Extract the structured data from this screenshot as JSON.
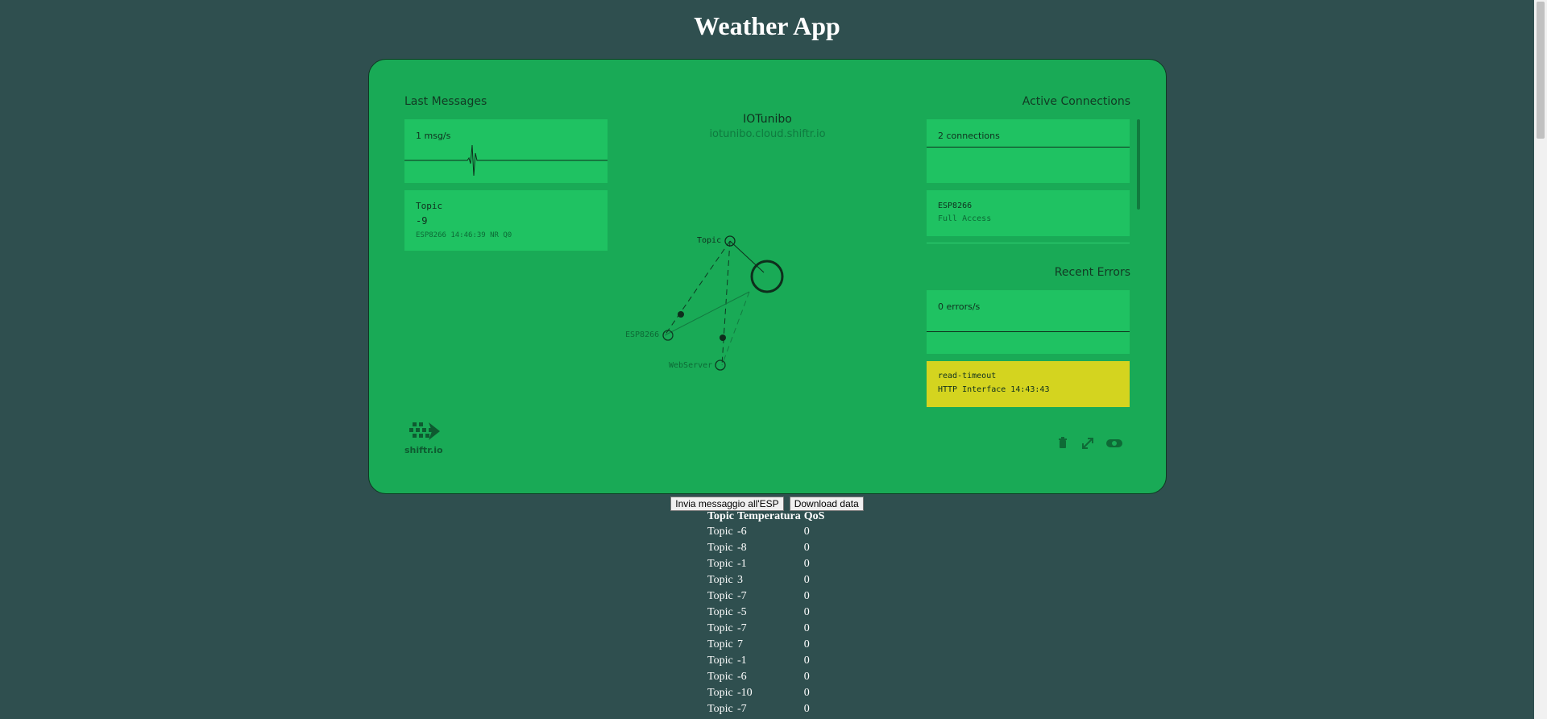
{
  "page": {
    "title": "Weather App"
  },
  "colors": {
    "background": "#2f4f4f",
    "panel": "#19aa56",
    "card": "#1fc262",
    "error_card": "#d4d41f"
  },
  "dashboard": {
    "last_messages": {
      "title": "Last Messages",
      "rate": "1 msg/s",
      "message": {
        "topic": "Topic",
        "value": "-9",
        "meta": "ESP8266 14:46:39 NR Q0"
      }
    },
    "broker": {
      "name": "IOTunibo",
      "host": "iotunibo.cloud.shiftr.io"
    },
    "graph": {
      "nodes": {
        "topic": "Topic",
        "esp": "ESP8266",
        "webserver": "WebServer"
      }
    },
    "active_connections": {
      "title": "Active Connections",
      "count": "2 connections",
      "client": {
        "name": "ESP8266",
        "access": "Full Access"
      }
    },
    "recent_errors": {
      "title": "Recent Errors",
      "rate": "0 errors/s",
      "error": {
        "name": "read-timeout",
        "meta": "HTTP Interface 14:43:43"
      }
    },
    "logo": {
      "text": "shiftr.io",
      "icon": "shiftr-logo-icon"
    },
    "controls": {
      "icons": [
        "trash-icon",
        "expand-icon",
        "eye-icon"
      ]
    }
  },
  "actions": {
    "send_label": "Invia messaggio all'ESP",
    "download_label": "Download data"
  },
  "table": {
    "headers": [
      "Topic",
      "Temperatura",
      "QoS"
    ],
    "rows": [
      {
        "topic": "Topic",
        "temp": "-6",
        "qos": "0"
      },
      {
        "topic": "Topic",
        "temp": "-8",
        "qos": "0"
      },
      {
        "topic": "Topic",
        "temp": "-1",
        "qos": "0"
      },
      {
        "topic": "Topic",
        "temp": "3",
        "qos": "0"
      },
      {
        "topic": "Topic",
        "temp": "-7",
        "qos": "0"
      },
      {
        "topic": "Topic",
        "temp": "-5",
        "qos": "0"
      },
      {
        "topic": "Topic",
        "temp": "-7",
        "qos": "0"
      },
      {
        "topic": "Topic",
        "temp": "7",
        "qos": "0"
      },
      {
        "topic": "Topic",
        "temp": "-1",
        "qos": "0"
      },
      {
        "topic": "Topic",
        "temp": "-6",
        "qos": "0"
      },
      {
        "topic": "Topic",
        "temp": "-10",
        "qos": "0"
      },
      {
        "topic": "Topic",
        "temp": "-7",
        "qos": "0"
      }
    ]
  }
}
